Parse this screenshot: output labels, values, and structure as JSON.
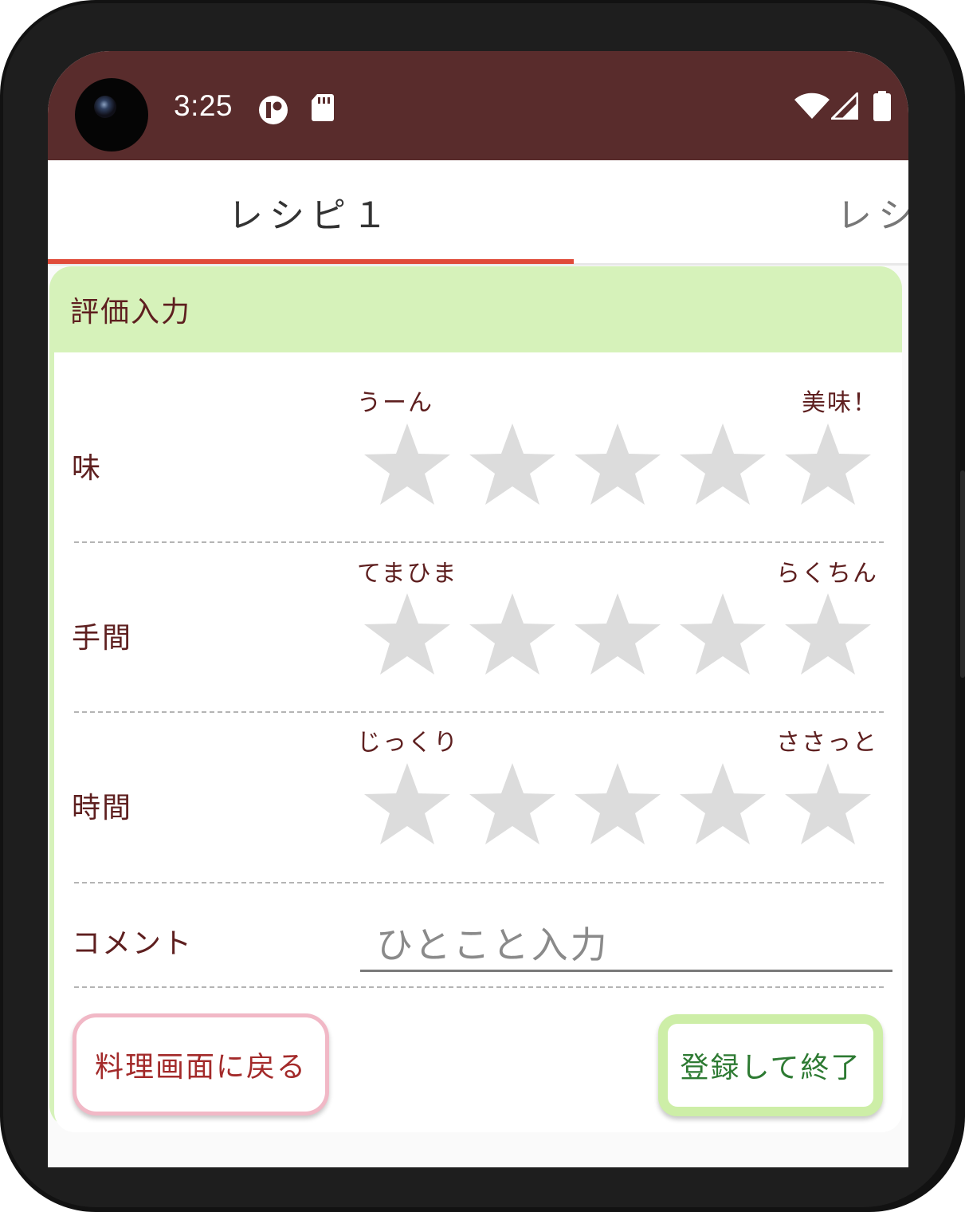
{
  "status_bar": {
    "time": "3:25",
    "icons_left": [
      "app-notification-icon",
      "sd-card-icon"
    ],
    "icons_right": [
      "wifi-icon",
      "cell-signal-icon",
      "battery-icon"
    ],
    "background_color": "#592c2c"
  },
  "tabs": [
    {
      "label": "レシピ１",
      "active": true
    },
    {
      "label": "レシ",
      "active": false
    }
  ],
  "accent_color": "#e04b3a",
  "card": {
    "title": "評価入力",
    "header_color": "#d6f2ba",
    "rows": [
      {
        "label": "味",
        "left_label": "うーん",
        "right_label": "美味！",
        "rating": 0,
        "max": 5
      },
      {
        "label": "手間",
        "left_label": "てまひま",
        "right_label": "らくちん",
        "rating": 0,
        "max": 5
      },
      {
        "label": "時間",
        "left_label": "じっくり",
        "right_label": "ささっと",
        "rating": 0,
        "max": 5
      }
    ],
    "comment": {
      "label": "コメント",
      "placeholder": "ひとこと入力",
      "value": ""
    }
  },
  "buttons": {
    "back_label": "料理画面に戻る",
    "save_label": "登録して終了"
  },
  "star_empty_color": "#dcdcdc"
}
